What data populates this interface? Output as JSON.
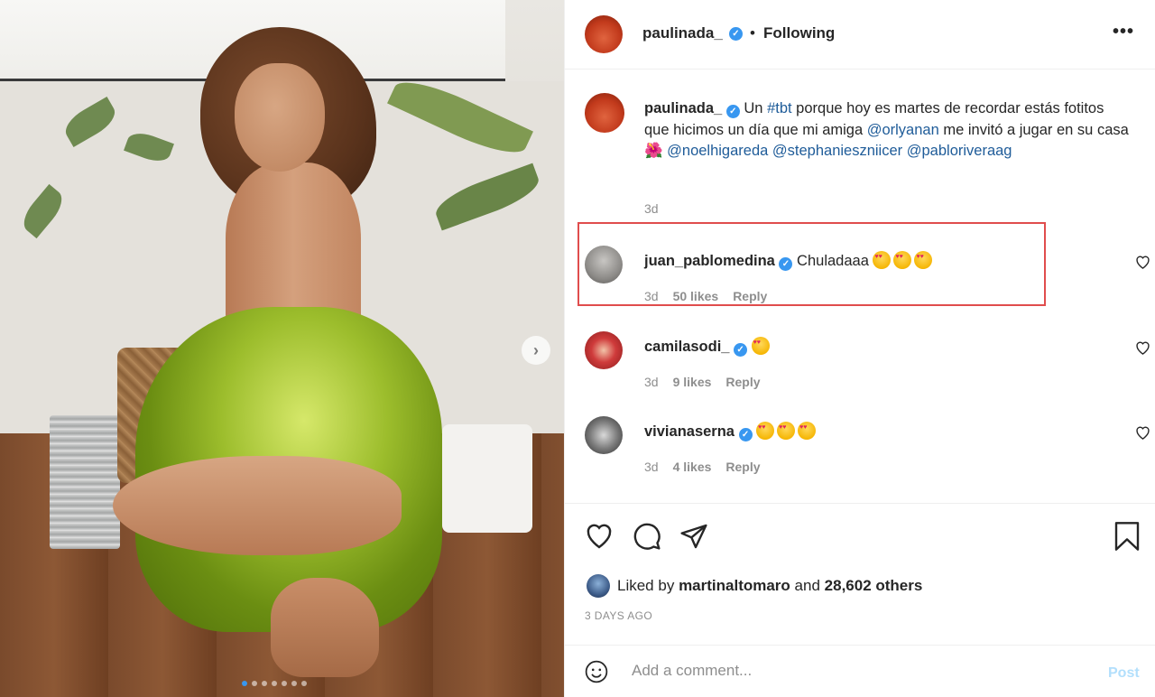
{
  "post_image": {
    "slide_count": 7,
    "active_slide": 1,
    "next_icon": "chevron-right-icon"
  },
  "header": {
    "username": "paulinada_",
    "separator": "•",
    "follow_status": "Following",
    "more_icon": "ellipsis-icon"
  },
  "caption": {
    "username": "paulinada_",
    "text_1": " Un ",
    "hashtag": "#tbt",
    "text_2": " porque hoy es martes de recordar estás fotitos que hicimos un día que mi amiga ",
    "mention_1": "@orlyanan",
    "text_3": " me invitó a jugar en su casa ",
    "flower_emoji": "🌺",
    "mention_2": "@noelhigareda",
    "mention_3": "@stephanieszniicer",
    "mention_4": "@pabloriveraag",
    "time": "3d"
  },
  "comments": [
    {
      "username": "juan_pablomedina",
      "text": "Chuladaaa",
      "emoji_count": 3,
      "time": "3d",
      "likes": "50 likes",
      "reply": "Reply"
    },
    {
      "username": "camilasodi_",
      "text": "",
      "emoji_count": 1,
      "time": "3d",
      "likes": "9 likes",
      "reply": "Reply"
    },
    {
      "username": "vivianaserna",
      "text": "",
      "emoji_count": 3,
      "time": "3d",
      "likes": "4 likes",
      "reply": "Reply"
    }
  ],
  "actions": {
    "like_icon": "heart-icon",
    "comment_icon": "comment-icon",
    "share_icon": "paper-plane-icon",
    "save_icon": "bookmark-icon"
  },
  "likes": {
    "prefix": "Liked by ",
    "user": "martinaltomaro",
    "mid": " and ",
    "count": "28,602 others"
  },
  "date": "3 DAYS AGO",
  "add_comment": {
    "placeholder": "Add a comment...",
    "post_label": "Post"
  },
  "colors": {
    "verified": "#3897f0",
    "link": "#1f5c99",
    "highlight": "#e04d4d",
    "post_disabled": "#b2dffc"
  }
}
